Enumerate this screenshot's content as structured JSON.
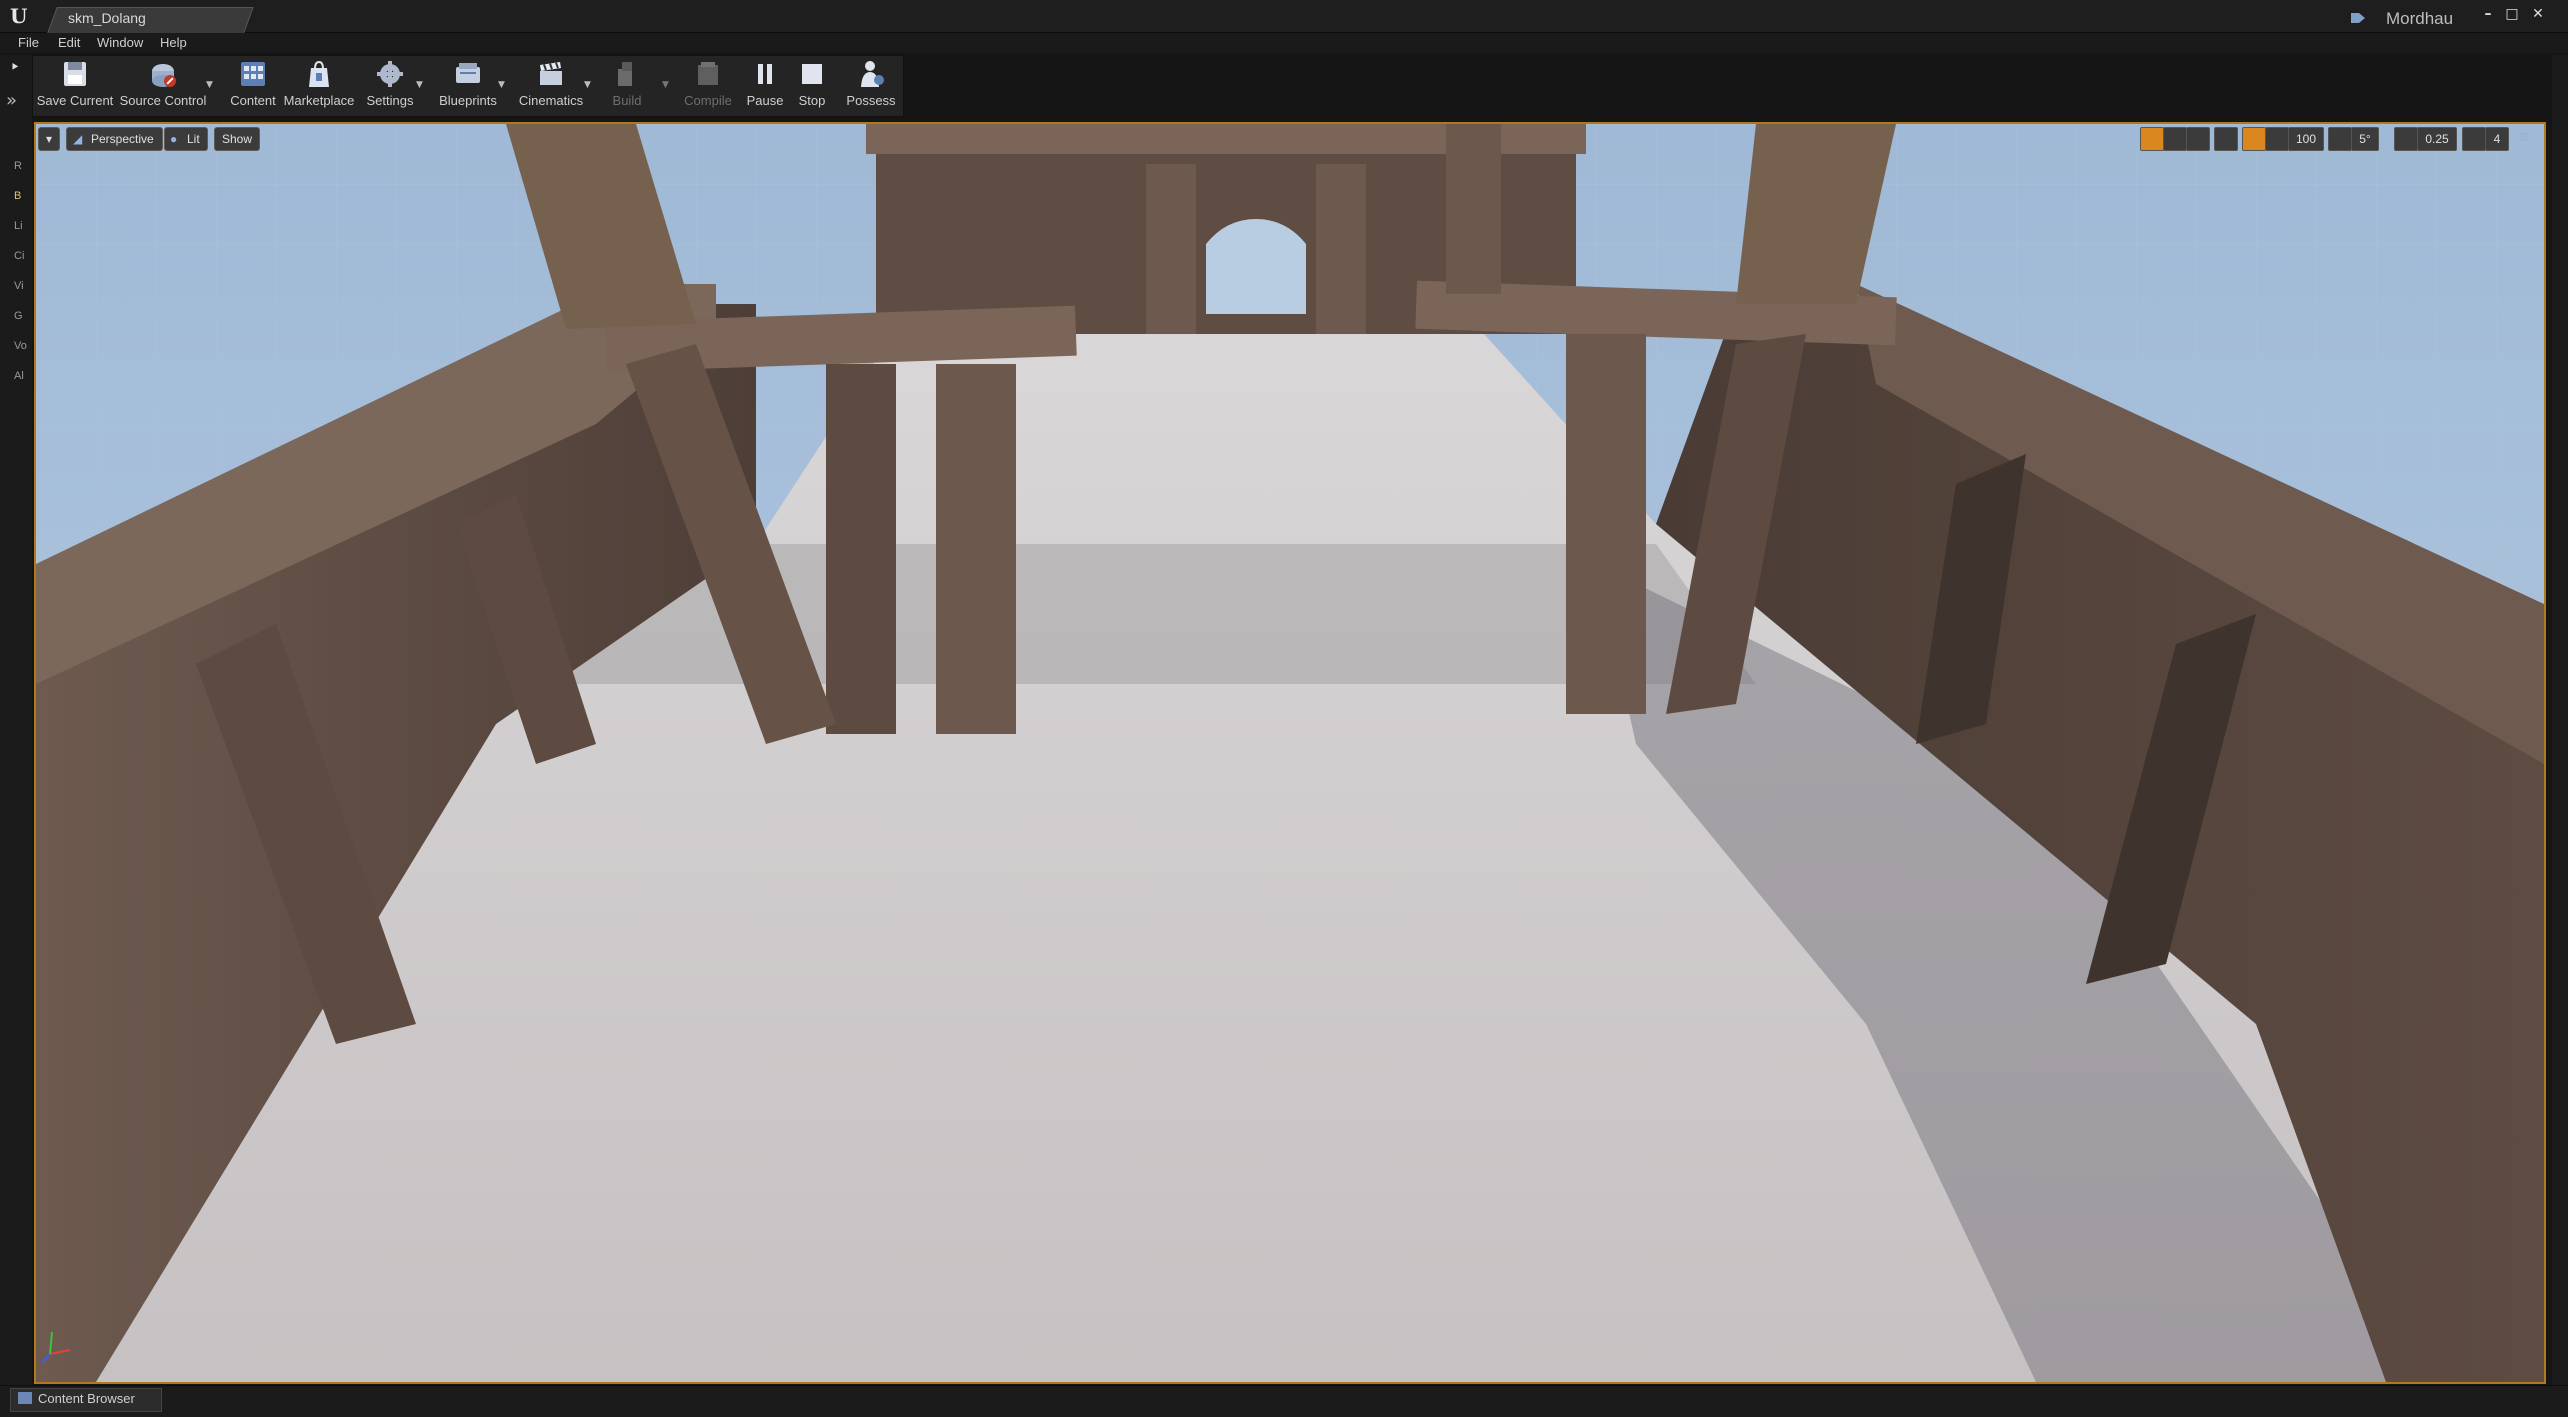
{
  "window": {
    "tab_title": "skm_Dolang",
    "project_name": "Mordhau",
    "min_glyph": "–",
    "max_glyph": "□",
    "close_glyph": "✕"
  },
  "menu": [
    "File",
    "Edit",
    "Window",
    "Help"
  ],
  "toolbar": {
    "save": "Save Current",
    "source_control": "Source Control",
    "content": "Content",
    "marketplace": "Marketplace",
    "settings": "Settings",
    "blueprints": "Blueprints",
    "cinematics": "Cinematics",
    "build": "Build",
    "compile": "Compile",
    "pause": "Pause",
    "stop": "Stop",
    "possess": "Possess"
  },
  "mode_strip": [
    "R",
    "B",
    "Li",
    "Ci",
    "Vi",
    "G",
    "Vo",
    "Al"
  ],
  "viewport": {
    "view_mode": "Perspective",
    "lighting": "Lit",
    "show": "Show",
    "grid_snap": "100",
    "rotation_snap": "5°",
    "scale_snap": "0.25",
    "camera_speed": "4",
    "accent_color": "#d9871e"
  },
  "bottom": {
    "content_browser": "Content Browser"
  }
}
